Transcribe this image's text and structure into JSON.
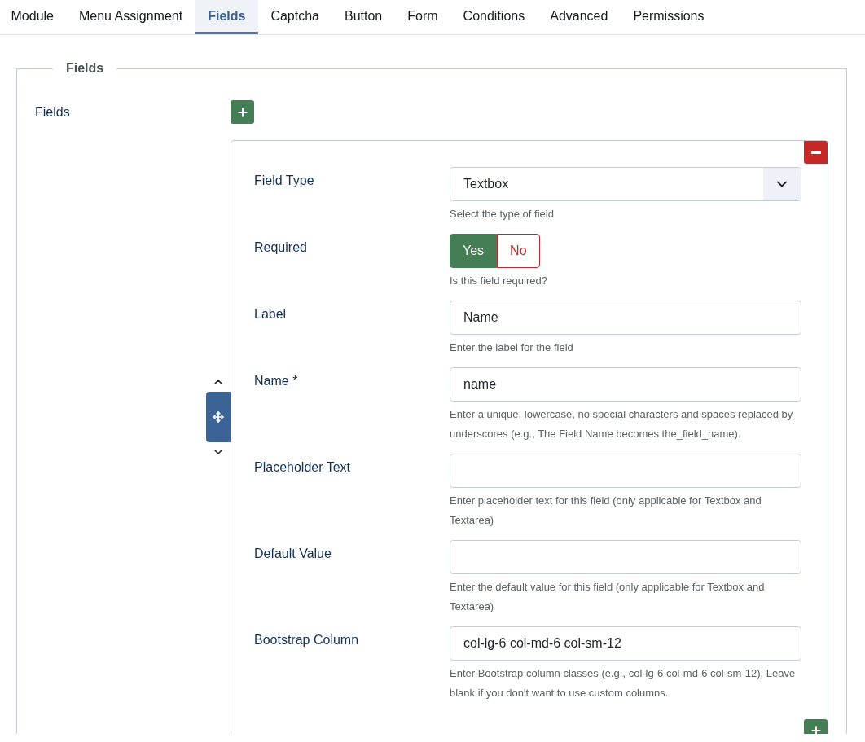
{
  "tabs": [
    {
      "label": "Module",
      "selected": false
    },
    {
      "label": "Menu Assignment",
      "selected": false
    },
    {
      "label": "Fields",
      "selected": true
    },
    {
      "label": "Captcha",
      "selected": false
    },
    {
      "label": "Button",
      "selected": false
    },
    {
      "label": "Form",
      "selected": false
    },
    {
      "label": "Conditions",
      "selected": false
    },
    {
      "label": "Advanced",
      "selected": false
    },
    {
      "label": "Permissions",
      "selected": false
    }
  ],
  "fieldset": {
    "legend": "Fields",
    "label": "Fields",
    "item": {
      "rows": [
        {
          "kind": "select",
          "label": "Field Type",
          "value": "Textbox",
          "help": "Select the type of field"
        },
        {
          "kind": "toggle",
          "label": "Required",
          "options": [
            {
              "label": "Yes",
              "selected": true
            },
            {
              "label": "No",
              "selected": false
            }
          ],
          "help": "Is this field required?"
        },
        {
          "kind": "text",
          "label": "Label",
          "value": "Name",
          "help": "Enter the label for the field"
        },
        {
          "kind": "text",
          "label": "Name *",
          "value": "name",
          "help": "Enter a unique, lowercase, no special characters and spaces replaced by underscores (e.g., The Field Name becomes the_field_name)."
        },
        {
          "kind": "text",
          "label": "Placeholder Text",
          "help": "Enter placeholder text for this field (only applicable for Textbox and Textarea)"
        },
        {
          "kind": "text",
          "label": "Default Value",
          "help": "Enter the default value for this field (only applicable for Textbox and Textarea)"
        },
        {
          "kind": "text",
          "label": "Bootstrap Column",
          "value": "col-lg-6 col-md-6 col-sm-12",
          "help": "Enter Bootstrap column classes (e.g., col-lg-6 col-md-6 col-sm-12). Leave blank if you don't want to use custom columns."
        }
      ]
    }
  }
}
